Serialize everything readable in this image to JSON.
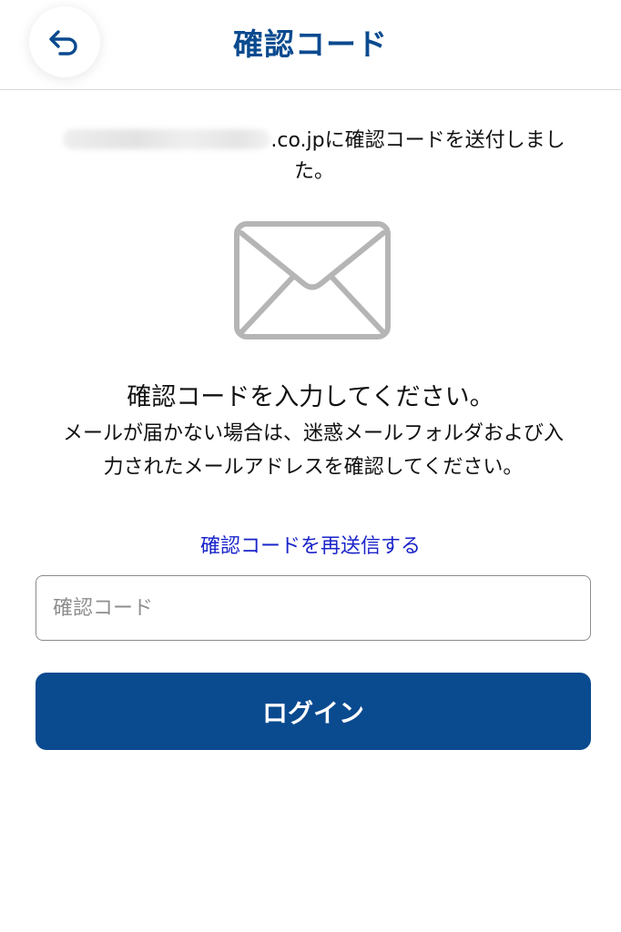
{
  "header": {
    "title": "確認コード",
    "back_icon": "undo-arrow-icon"
  },
  "sent_message": {
    "email_domain": ".co.jpに確認コードを送付しました。"
  },
  "illustration": {
    "icon": "envelope-icon"
  },
  "instruction": {
    "title": "確認コードを入力してください。",
    "line1": "メールが届かない場合は、迷惑メールフォルダおよび入",
    "line2": "力されたメールアドレスを確認してください。"
  },
  "resend": {
    "label": "確認コードを再送信する"
  },
  "code_input": {
    "value": "",
    "placeholder": "確認コード"
  },
  "login": {
    "label": "ログイン"
  },
  "colors": {
    "brand": "#0a4a8f",
    "link": "#1a24c9",
    "icon_gray": "#b5b5b5"
  }
}
